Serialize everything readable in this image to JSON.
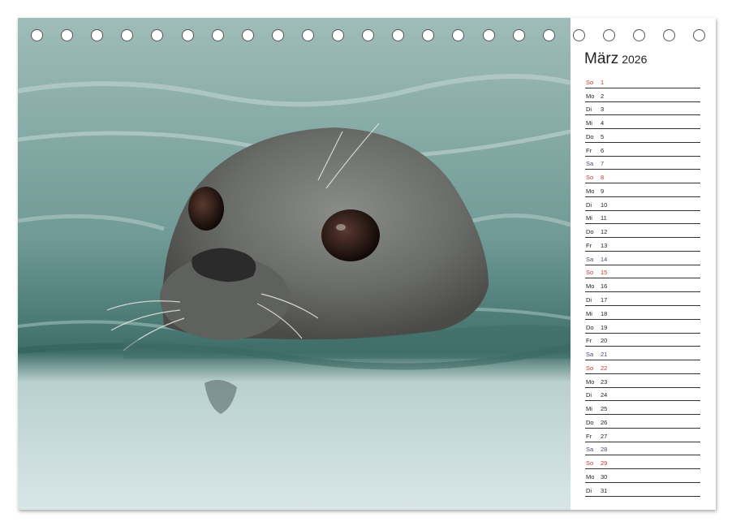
{
  "calendar": {
    "month": "März",
    "year": "2026",
    "days": [
      {
        "wd": "So",
        "n": "1",
        "type": "sun"
      },
      {
        "wd": "Mo",
        "n": "2",
        "type": "wk"
      },
      {
        "wd": "Di",
        "n": "3",
        "type": "wk"
      },
      {
        "wd": "Mi",
        "n": "4",
        "type": "wk"
      },
      {
        "wd": "Do",
        "n": "5",
        "type": "wk"
      },
      {
        "wd": "Fr",
        "n": "6",
        "type": "wk"
      },
      {
        "wd": "Sa",
        "n": "7",
        "type": "sat"
      },
      {
        "wd": "So",
        "n": "8",
        "type": "sun"
      },
      {
        "wd": "Mo",
        "n": "9",
        "type": "wk"
      },
      {
        "wd": "Di",
        "n": "10",
        "type": "wk"
      },
      {
        "wd": "Mi",
        "n": "11",
        "type": "wk"
      },
      {
        "wd": "Do",
        "n": "12",
        "type": "wk"
      },
      {
        "wd": "Fr",
        "n": "13",
        "type": "wk"
      },
      {
        "wd": "Sa",
        "n": "14",
        "type": "sat"
      },
      {
        "wd": "So",
        "n": "15",
        "type": "sun"
      },
      {
        "wd": "Mo",
        "n": "16",
        "type": "wk"
      },
      {
        "wd": "Di",
        "n": "17",
        "type": "wk"
      },
      {
        "wd": "Mi",
        "n": "18",
        "type": "wk"
      },
      {
        "wd": "Do",
        "n": "19",
        "type": "wk"
      },
      {
        "wd": "Fr",
        "n": "20",
        "type": "wk"
      },
      {
        "wd": "Sa",
        "n": "21",
        "type": "sat"
      },
      {
        "wd": "So",
        "n": "22",
        "type": "sun"
      },
      {
        "wd": "Mo",
        "n": "23",
        "type": "wk"
      },
      {
        "wd": "Di",
        "n": "24",
        "type": "wk"
      },
      {
        "wd": "Mi",
        "n": "25",
        "type": "wk"
      },
      {
        "wd": "Do",
        "n": "26",
        "type": "wk"
      },
      {
        "wd": "Fr",
        "n": "27",
        "type": "wk"
      },
      {
        "wd": "Sa",
        "n": "28",
        "type": "sat"
      },
      {
        "wd": "So",
        "n": "29",
        "type": "sun"
      },
      {
        "wd": "Mo",
        "n": "30",
        "type": "wk"
      },
      {
        "wd": "Di",
        "n": "31",
        "type": "wk"
      }
    ]
  },
  "photo": {
    "subject": "seal-head-in-water",
    "colors": {
      "water": "#7fa5a3",
      "water_light": "#c6dad8",
      "seal": "#6b6e6c",
      "seal_dark": "#3a3c3b"
    }
  },
  "binding": {
    "ring_count": 23
  }
}
